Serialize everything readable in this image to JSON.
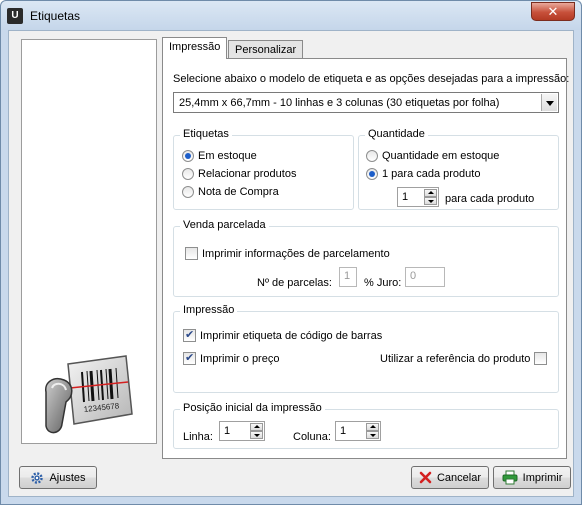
{
  "window": {
    "title": "Etiquetas",
    "close_glyph": "✕"
  },
  "tabs": [
    {
      "label": "Impressão"
    },
    {
      "label": "Personalizar"
    }
  ],
  "intro_text": "Selecione abaixo o modelo de etiqueta e as opções desejadas para a impressão:",
  "model_select": {
    "value": "25,4mm x 66,7mm - 10 linhas e 3 colunas (30 etiquetas por folha)"
  },
  "etiquetas_group": {
    "legend": "Etiquetas",
    "options": [
      "Em estoque",
      "Relacionar produtos",
      "Nota de Compra"
    ],
    "selected": "Em estoque"
  },
  "quantidade_group": {
    "legend": "Quantidade",
    "options": [
      "Quantidade em estoque",
      "1 para cada produto"
    ],
    "selected": "1 para cada produto",
    "per_product_value": "1",
    "per_product_suffix": "para cada produto"
  },
  "venda_group": {
    "legend": "Venda parcelada",
    "checkbox_label": "Imprimir informações de parcelamento",
    "checked": false,
    "parcelas_label": "Nº de parcelas:",
    "parcelas_value": "1",
    "juro_label": "% Juro:",
    "juro_value": "0"
  },
  "impressao_group": {
    "legend": "Impressão",
    "barcode_label": "Imprimir etiqueta de código de barras",
    "barcode_checked": true,
    "price_label": "Imprimir o preço",
    "price_checked": true,
    "ref_label": "Utilizar a referência do produto",
    "ref_checked": false
  },
  "posicao_group": {
    "legend": "Posição inicial da impressão",
    "linha_label": "Linha:",
    "linha_value": "1",
    "coluna_label": "Coluna:",
    "coluna_value": "1"
  },
  "buttons": {
    "ajustes": "Ajustes",
    "cancelar": "Cancelar",
    "imprimir": "Imprimir"
  },
  "logo": {
    "barcode_digits": "12345678"
  },
  "colors": {
    "accent": "#1d5ec9",
    "cancel_icon": "#d42020",
    "print_icon": "#2f9a3a"
  }
}
